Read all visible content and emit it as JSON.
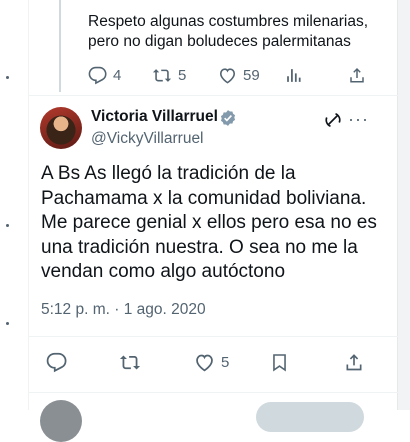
{
  "reply": {
    "text": "Respeto algunas costumbres milenarias, pero no digan boludeces palermitanas",
    "stats": {
      "replies": "4",
      "reposts": "5",
      "likes": "59"
    }
  },
  "tweet": {
    "display_name": "Victoria Villarruel",
    "handle": "@VickyVillarruel",
    "text": "A Bs As llegó la tradición de la Pachamama x la comunidad boliviana. Me parece genial x ellos pero esa no es una tradición nuestra. O sea no me la vendan como algo autóctono",
    "timestamp": "5:12 p. m. · 1 ago. 2020",
    "stats": {
      "likes": "5"
    }
  },
  "icons": [
    "reply-icon",
    "repost-icon",
    "like-icon",
    "views-icon",
    "share-icon",
    "bookmark-icon",
    "verified-icon",
    "grok-icon",
    "more-icon"
  ],
  "colors": {
    "text": "#0f1419",
    "secondary": "#536471",
    "verified": "#829aab",
    "divider": "#eff3f4"
  }
}
